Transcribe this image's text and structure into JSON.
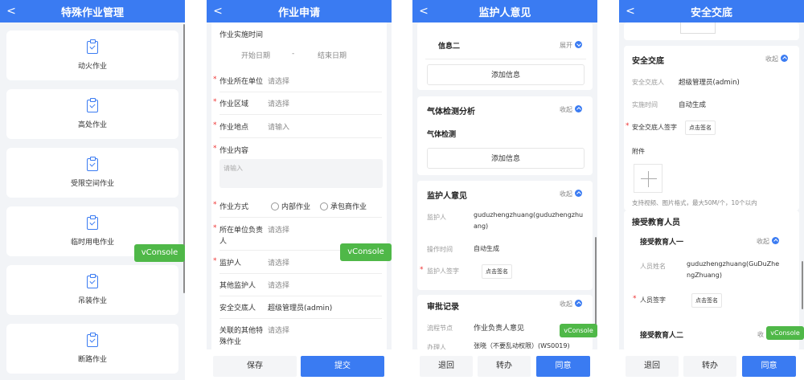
{
  "screen1": {
    "title": "特殊作业管理",
    "items": [
      "动火作业",
      "高处作业",
      "受限空间作业",
      "临时用电作业",
      "吊装作业",
      "断路作业"
    ]
  },
  "vconsole_label": "vConsole",
  "screen2": {
    "title": "作业申请",
    "time_label": "作业实施时间",
    "start_placeholder": "开始日期",
    "dash": "-",
    "end_placeholder": "结束日期",
    "rows": [
      {
        "label": "作业所在单位",
        "value": "请选择",
        "required": "*"
      },
      {
        "label": "作业区域",
        "value": "请选择",
        "required": "*"
      },
      {
        "label": "作业地点",
        "value": "请输入",
        "required": "*"
      },
      {
        "label": "作业内容",
        "value": "",
        "required": "*"
      }
    ],
    "content_placeholder": "请输入",
    "method_label": "作业方式",
    "method_required": "*",
    "method_options": [
      "内部作业",
      "承包商作业"
    ],
    "owner_label_1": "所在单位负责",
    "owner_label_2": "人",
    "owner_value": "请选择",
    "owner_required": "*",
    "guardian_label": "监护人",
    "guardian_value": "请选择",
    "guardian_required": "*",
    "other_guardian_label": "其他监护人",
    "other_guardian_value": "请选择",
    "safety_label": "安全交底人",
    "safety_value": "超级管理员(admin)",
    "related_label_1": "关联的其他特",
    "related_label_2": "殊作业",
    "related_value": "请选择",
    "save_btn": "保存",
    "submit_btn": "提交"
  },
  "screen3": {
    "title": "监护人意见",
    "info2": "信息二",
    "expand": "展开",
    "add_info": "添加信息",
    "gas_title": "气体检测分析",
    "collapse": "收起",
    "gas_sub": "气体检测",
    "guardian_title": "监护人意见",
    "guardian_key": "监护人",
    "guardian_value_1": "guduzhengzhuang(guduzhengzhu",
    "guardian_value_2": "ang)",
    "optime_key": "操作时间",
    "optime_value": "自动生成",
    "sign_key": "监护人签字",
    "sign_btn": "点击签名",
    "approve_title": "审批记录",
    "node_key": "流程节点",
    "node_value": "作业负责人意见",
    "handler_key": "办理人",
    "handler_value": "张晓（不要乱动权限）(WS0019)",
    "back_btn": "退回",
    "transfer_btn": "转办",
    "agree_btn": "同意"
  },
  "screen4": {
    "title": "安全交底",
    "safety_title": "安全交底",
    "collapse": "收起",
    "person_key": "安全交底人",
    "person_value": "超级管理员(admin)",
    "time_key": "实施时间",
    "time_value": "自动生成",
    "sign_key": "安全交底人签字",
    "sign_btn": "点击签名",
    "attach_key": "附件",
    "attach_hint": "支持视频、图片格式，最大50M/个，10个以内",
    "edu_title": "接受教育人员",
    "edu1_title": "接受教育人一",
    "name_key": "人员姓名",
    "name_value_1": "guduzhengzhuang(GuDuZhe",
    "name_value_2": "ngZhuang)",
    "person_sign_key": "人员签字",
    "person_sign_btn": "点击签名",
    "edu2_title": "接受教育人二",
    "edu2_fold": "收",
    "back_btn": "退回",
    "transfer_btn": "转办",
    "agree_btn": "同意"
  }
}
